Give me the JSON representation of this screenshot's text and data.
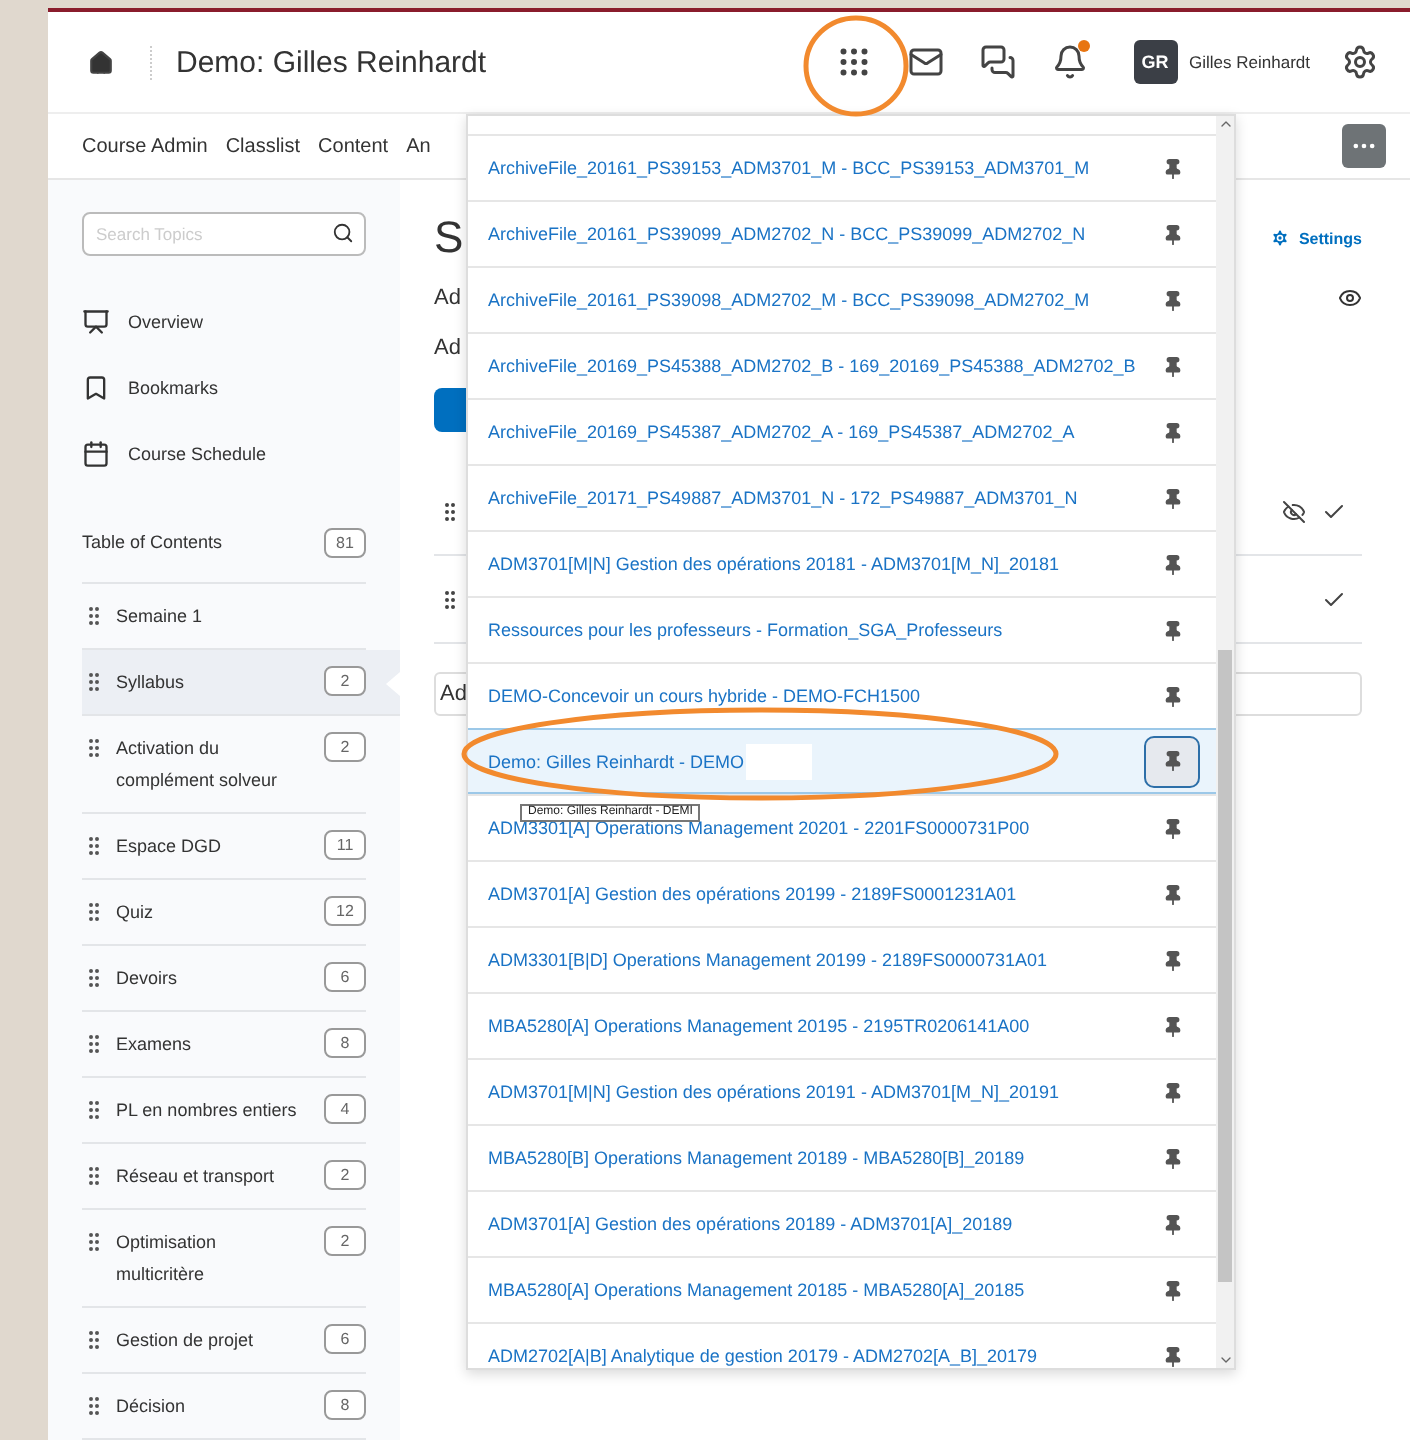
{
  "header": {
    "title": "Demo: Gilles Reinhardt",
    "user_initials": "GR",
    "user_name": "Gilles Reinhardt",
    "notification": true
  },
  "nav": {
    "items": [
      "Course Admin",
      "Classlist",
      "Content",
      "An"
    ]
  },
  "sidebar": {
    "search": {
      "placeholder": "Search Topics"
    },
    "links": [
      {
        "kind": "overview",
        "label": "Overview"
      },
      {
        "kind": "bookmark",
        "label": "Bookmarks"
      },
      {
        "kind": "schedule",
        "label": "Course Schedule"
      }
    ],
    "toc": {
      "label": "Table of Contents",
      "count": "81"
    },
    "items": [
      {
        "label": "Semaine 1",
        "selected": false
      },
      {
        "label": "Syllabus",
        "count": "2",
        "selected": true
      },
      {
        "label": "Activation du complément solveur",
        "count": "2",
        "selected": false
      },
      {
        "label": "Espace DGD",
        "count": "11",
        "selected": false
      },
      {
        "label": "Quiz",
        "count": "12",
        "selected": false
      },
      {
        "label": "Devoirs",
        "count": "6",
        "selected": false
      },
      {
        "label": "Examens",
        "count": "8",
        "selected": false
      },
      {
        "label": "PL en nombres entiers",
        "count": "4",
        "selected": false
      },
      {
        "label": "Réseau et transport",
        "count": "2",
        "selected": false
      },
      {
        "label": "Optimisation multicritère",
        "count": "2",
        "selected": false
      },
      {
        "label": "Gestion de projet",
        "count": "6",
        "selected": false
      },
      {
        "label": "Décision",
        "count": "8",
        "selected": false
      }
    ]
  },
  "content": {
    "heading": "S",
    "settings": "Settings",
    "line_1": "Ad",
    "line_2": "Ad",
    "field_value": "Ad"
  },
  "course_menu": {
    "items": [
      {
        "label": "ArchiveFile_20161_PS39153_ADM3701_M - BCC_PS39153_ADM3701_M",
        "selected": false
      },
      {
        "label": "ArchiveFile_20161_PS39099_ADM2702_N - BCC_PS39099_ADM2702_N",
        "selected": false
      },
      {
        "label": "ArchiveFile_20161_PS39098_ADM2702_M - BCC_PS39098_ADM2702_M",
        "selected": false
      },
      {
        "label": "ArchiveFile_20169_PS45388_ADM2702_B - 169_20169_PS45388_ADM2702_B",
        "selected": false
      },
      {
        "label": "ArchiveFile_20169_PS45387_ADM2702_A - 169_PS45387_ADM2702_A",
        "selected": false
      },
      {
        "label": "ArchiveFile_20171_PS49887_ADM3701_N - 172_PS49887_ADM3701_N",
        "selected": false
      },
      {
        "label": "ADM3701[M|N] Gestion des opérations 20181 - ADM3701[M_N]_20181",
        "selected": false
      },
      {
        "label": "Ressources pour les professeurs - Formation_SGA_Professeurs",
        "selected": false
      },
      {
        "label": "DEMO-Concevoir un cours hybride - DEMO-FCH1500",
        "selected": false
      },
      {
        "label": "Demo: Gilles Reinhardt - DEMO",
        "selected": true,
        "redacted": true
      },
      {
        "label": "ADM3301[A] Operations Management 20201 - 2201FS0000731P00",
        "selected": false
      },
      {
        "label": "ADM3701[A] Gestion des opérations 20199 - 2189FS0001231A01",
        "selected": false
      },
      {
        "label": "ADM3301[B|D] Operations Management 20199 - 2189FS0000731A01",
        "selected": false
      },
      {
        "label": "MBA5280[A] Operations Management 20195 - 2195TR0206141A00",
        "selected": false
      },
      {
        "label": "ADM3701[M|N] Gestion des opérations 20191 - ADM3701[M_N]_20191",
        "selected": false
      },
      {
        "label": "MBA5280[B] Operations Management 20189 - MBA5280[B]_20189",
        "selected": false
      },
      {
        "label": "ADM3701[A] Gestion des opérations 20189 - ADM3701[A]_20189",
        "selected": false
      },
      {
        "label": "MBA5280[A] Operations Management 20185 - MBA5280[A]_20185",
        "selected": false
      },
      {
        "label": "ADM2702[A|B] Analytique de gestion 20179 - ADM2702[A_B]_20179",
        "selected": false
      }
    ],
    "tooltip": "Demo: Gilles Reinhardt - DEMI"
  }
}
